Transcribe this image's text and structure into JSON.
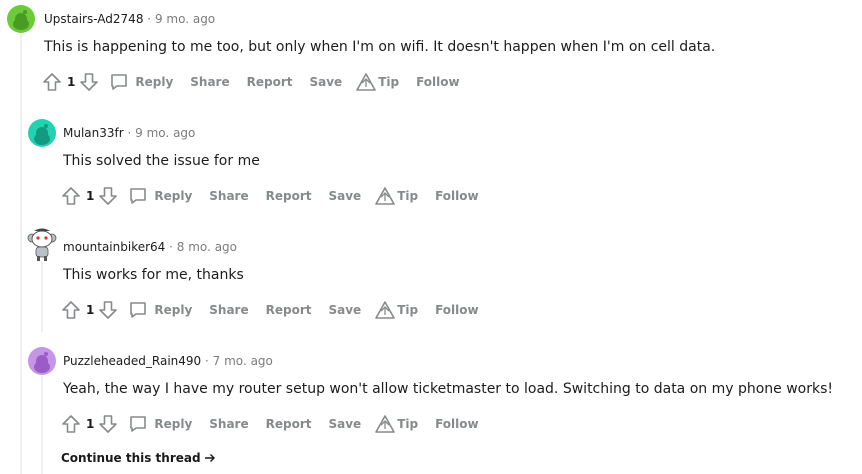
{
  "comments": [
    {
      "author": "Upstairs-Ad2748",
      "age": "9 mo. ago",
      "text": "This is happening to me too, but only when I'm on wifi. It doesn't happen when I'm on cell data.",
      "score": "1",
      "avatar_color": "#6ccb3a"
    },
    {
      "author": "Mulan33fr",
      "age": "9 mo. ago",
      "text": "This solved the issue for me",
      "score": "1",
      "avatar_color": "#24d1b0"
    },
    {
      "author": "mountainbiker64",
      "age": "8 mo. ago",
      "text": "This works for me, thanks",
      "score": "1",
      "avatar_color": "#ffffff"
    },
    {
      "author": "Puzzleheaded_Rain490",
      "age": "7 mo. ago",
      "text": "Yeah, the way I have my router setup won't allow ticketmaster to load. Switching to data on my phone works!",
      "score": "1",
      "avatar_color": "#c596e6"
    }
  ],
  "actions": {
    "reply": "Reply",
    "share": "Share",
    "report": "Report",
    "save": "Save",
    "tip": "Tip",
    "follow": "Follow"
  },
  "separator": "·",
  "continue_label": "Continue this thread",
  "colors": {
    "meta_gray": "#7c7c7c",
    "action_gray": "#878a8c",
    "thread_line": "#edeff1"
  }
}
